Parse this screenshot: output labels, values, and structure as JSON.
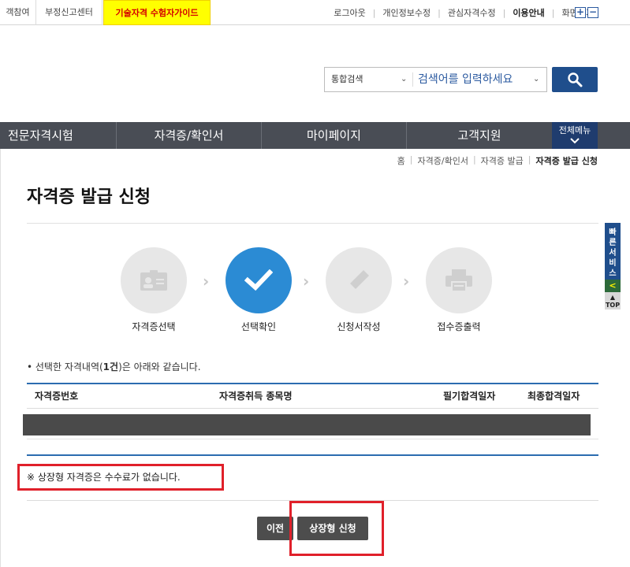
{
  "topbar": {
    "tab1": "객참여",
    "tab2": "부정신고센터",
    "tab3": "기술자격 수험자가이드",
    "util_links": [
      "로그아웃",
      "개인정보수정",
      "관심자격수정",
      "이용안내",
      "화면크기"
    ],
    "zoom_in": "+",
    "zoom_out": "−"
  },
  "search": {
    "scope": "통합검색",
    "placeholder": "검색어를 입력하세요"
  },
  "gnb": {
    "items": [
      "전문자격시험",
      "자격증/확인서",
      "마이페이지",
      "고객지원"
    ],
    "all_menu": "전체메뉴"
  },
  "breadcrumb": {
    "items": [
      "홈",
      "자격증/확인서",
      "자격증 발급"
    ],
    "current": "자격증 발급 신청"
  },
  "page_title": "자격증 발급 신청",
  "quick": {
    "label": "빠른서비스",
    "arrow": "<",
    "top": "TOP"
  },
  "steps": [
    {
      "label": "자격증선택",
      "icon": "id-card-icon",
      "active": false
    },
    {
      "label": "선택확인",
      "icon": "check-icon",
      "active": true
    },
    {
      "label": "신청서작성",
      "icon": "pencil-icon",
      "active": false
    },
    {
      "label": "접수증출력",
      "icon": "printer-icon",
      "active": false
    }
  ],
  "notice": {
    "prefix": "• 선택한 자격내역(",
    "count": "1건",
    "suffix": ")은 아래와 같습니다."
  },
  "table": {
    "headers": [
      "자격증번호",
      "자격증취득 종목명",
      "필기합격일자",
      "최종합격일자"
    ]
  },
  "fee_note": "※ 상장형 자격증은 수수료가 없습니다.",
  "buttons": {
    "prev": "이전",
    "apply": "상장형 신청"
  },
  "colors": {
    "accent": "#2b8bd4",
    "highlight": "#e0202a",
    "gnb": "#494d55",
    "brand": "#1f4e8c"
  }
}
